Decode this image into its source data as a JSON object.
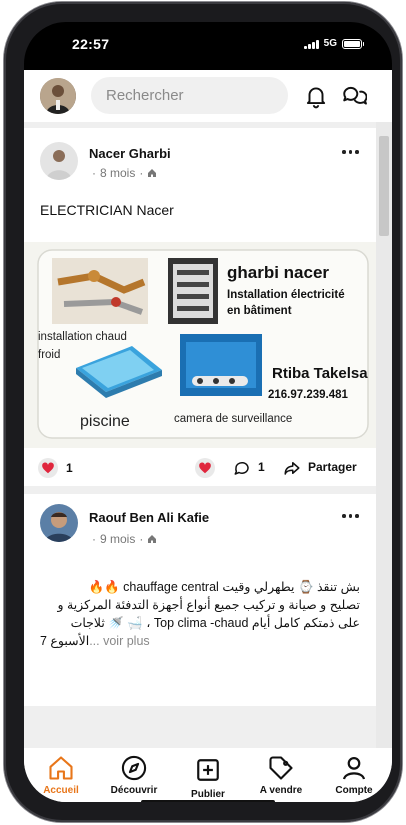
{
  "status": {
    "time": "22:57",
    "network": "5G"
  },
  "search": {
    "placeholder": "Rechercher"
  },
  "icons": {
    "notifications": "bell-icon",
    "messages": "chat-bubbles-icon",
    "more": "more-dots-icon",
    "audience": "home-small-icon",
    "like": "heart-icon",
    "comment": "comment-icon",
    "share": "share-arrow-icon"
  },
  "colors": {
    "accent": "#e8761a",
    "heart": "#e0263d"
  },
  "posts": [
    {
      "author": "Nacer Gharbi",
      "time": "8 mois",
      "text": "ELECTRICIAN Nacer",
      "likes": "1",
      "comments": "1",
      "share_label": "Partager",
      "image_text": {
        "name": "gharbi nacer",
        "line1": "Installation électricité",
        "line2": "en bâtiment",
        "service1a": "installation chaud",
        "service1b": "froid",
        "brand": "Rtiba Takelsa",
        "phone": "216.97.239.481",
        "service2": "piscine",
        "service3": "camera de surveillance"
      }
    },
    {
      "author": "Raouf Ben Ali Kafie",
      "time": "9 mois",
      "line1": "بش تنقذ ⌚ يطهرلي وقيت chauffage central 🔥🔥",
      "line2": "تصليح و صيانة و تركيب جميع أنواع أجهزة التدفئة المركزية و",
      "line3": "على ذمتكم كامل أيام Top clima -chaud ، 🛁 🚿 ثلاجات",
      "line4": "الأسبوع 7",
      "more_label": "... voir plus"
    }
  ],
  "nav": [
    {
      "label": "Accueil",
      "icon": "home-icon",
      "active": true
    },
    {
      "label": "Découvrir",
      "icon": "compass-icon",
      "active": false
    },
    {
      "label": "Publier",
      "icon": "plus-square-icon",
      "active": false
    },
    {
      "label": "A vendre",
      "icon": "tag-icon",
      "active": false
    },
    {
      "label": "Compte",
      "icon": "user-icon",
      "active": false
    }
  ]
}
